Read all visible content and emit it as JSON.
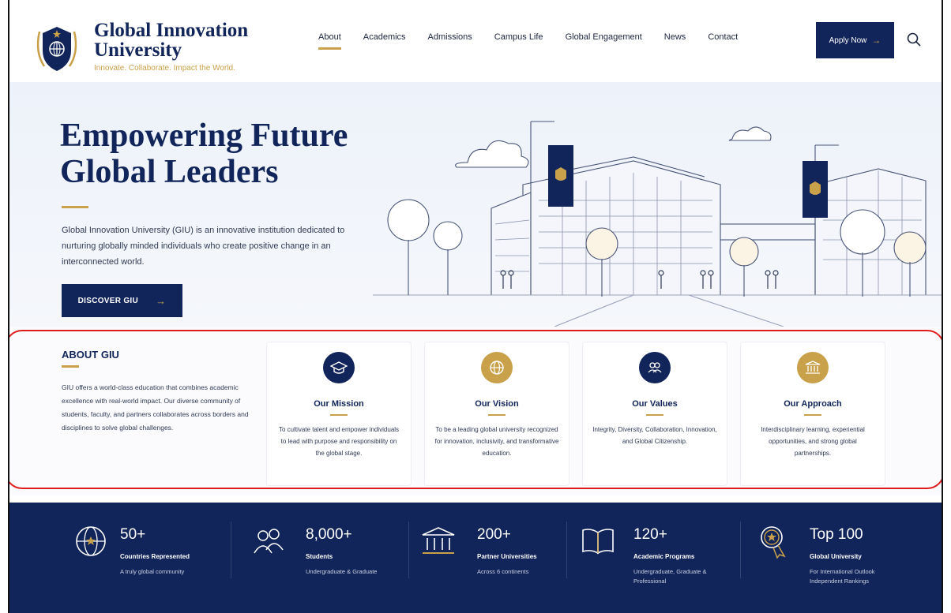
{
  "brand": {
    "name_line1": "Global Innovation",
    "name_line2": "University",
    "tagline": "Innovate. Collaborate. Impact the World.",
    "primary_color": "#12255a",
    "accent_color": "#c8a14a"
  },
  "nav": {
    "items": [
      {
        "label": "About",
        "active": true
      },
      {
        "label": "Academics",
        "active": false
      },
      {
        "label": "Admissions",
        "active": false
      },
      {
        "label": "Campus Life",
        "active": false
      },
      {
        "label": "Global Engagement",
        "active": false
      },
      {
        "label": "News",
        "active": false
      },
      {
        "label": "Contact",
        "active": false
      }
    ],
    "apply_label": "Apply Now",
    "apply_icon": "arrow-right-icon",
    "search_icon": "search-icon"
  },
  "hero": {
    "title_line1": "Empowering Future",
    "title_line2": "Global Leaders",
    "description": "Global Innovation University (GIU) is an innovative institution dedicated to nurturing globally minded individuals who create positive change in an interconnected world.",
    "button_label": "DISCOVER GIU"
  },
  "about": {
    "heading": "ABOUT GIU",
    "text": "GIU offers a world-class education that combines academic excellence with real-world impact. Our diverse community of students, faculty, and partners collaborates across borders and disciplines to solve global challenges.",
    "highlight_color": "#e01b1b",
    "cards": [
      {
        "icon": "graduation-cap-icon",
        "title": "Our Mission",
        "text": "To cultivate talent and empower individuals to lead with purpose and responsibility on the global stage."
      },
      {
        "icon": "globe-icon",
        "title": "Our Vision",
        "text": "To be a leading global university recognized for innovation, inclusivity, and transformative education."
      },
      {
        "icon": "people-icon",
        "title": "Our Values",
        "text": "Integrity, Diversity, Collaboration, Innovation, and Global Citizenship."
      },
      {
        "icon": "institution-icon",
        "title": "Our Approach",
        "text": "Interdisciplinary learning, experiential opportunities, and strong global partnerships."
      }
    ]
  },
  "stats": [
    {
      "icon": "globe-star-icon",
      "value": "50+",
      "label": "Countries Represented",
      "sub": "A truly global community"
    },
    {
      "icon": "students-icon",
      "value": "8,000+",
      "label": "Students",
      "sub": "Undergraduate & Graduate"
    },
    {
      "icon": "institution-icon",
      "value": "200+",
      "label": "Partner Universities",
      "sub": "Across 6 continents"
    },
    {
      "icon": "open-book-icon",
      "value": "120+",
      "label": "Academic Programs",
      "sub": "Undergraduate, Graduate & Professional"
    },
    {
      "icon": "award-badge-icon",
      "value": "Top 100",
      "label": "Global University",
      "sub": "For International Outlook Independent Rankings"
    }
  ]
}
